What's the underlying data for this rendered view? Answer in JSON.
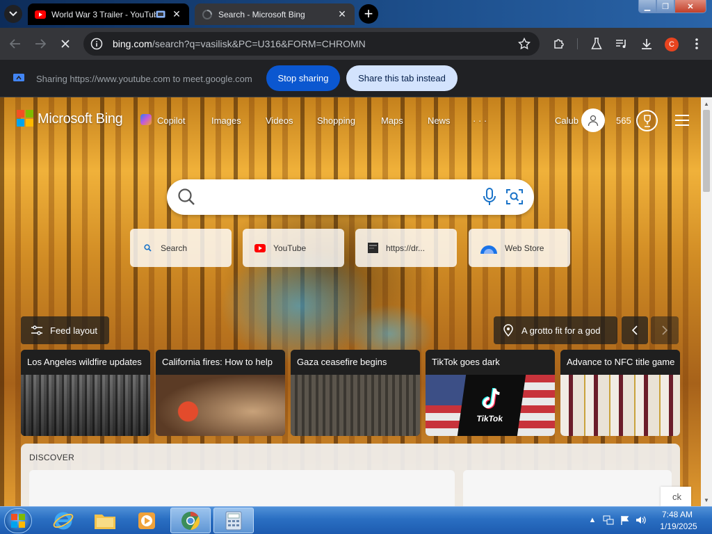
{
  "browser": {
    "tabs": [
      {
        "title": "World War 3 Trailer - YouTube",
        "favicon": "youtube-icon",
        "sharing": true
      },
      {
        "title": "Search - Microsoft Bing",
        "favicon": "loading-icon",
        "active": true
      }
    ],
    "new_tab": "+",
    "url_host": "bing.com",
    "url_path": "/search?q=vasilisk&PC=U316&FORM=CHROMN",
    "profile_initial": "C",
    "profile_color": "#e8441f"
  },
  "share_bar": {
    "message": "Sharing https://www.youtube.com to meet.google.com",
    "stop_label": "Stop sharing",
    "share_tab_label": "Share this tab instead"
  },
  "bing": {
    "logo_text": "Microsoft Bing",
    "nav": [
      "Copilot",
      "Images",
      "Videos",
      "Shopping",
      "Maps",
      "News",
      "· · ·"
    ],
    "user_name": "Calub",
    "points": "565",
    "quick_links": [
      {
        "label": "Search",
        "icon": "search-icon"
      },
      {
        "label": "YouTube",
        "icon": "youtube-icon"
      },
      {
        "label": "https://dr...",
        "icon": "site-icon"
      },
      {
        "label": "Web Store",
        "icon": "web-store-icon"
      }
    ],
    "feed_layout_label": "Feed layout",
    "image_caption": "A grotto fit for a god",
    "cards": [
      {
        "title": "Los Angeles wildfire updates"
      },
      {
        "title": "California fires: How to help"
      },
      {
        "title": "Gaza ceasefire begins"
      },
      {
        "title": "TikTok goes dark",
        "badge": "TikTok"
      },
      {
        "title": "Advance to NFC title game"
      }
    ],
    "discover_label": "DISCOVER",
    "feedback_partial": "ck"
  },
  "taskbar": {
    "time": "7:48 AM",
    "date": "1/19/2025",
    "tray_arrow": "▲"
  },
  "colors": {
    "accent_blue": "#0b57d0",
    "share_tab_bg": "#d3e3fd",
    "youtube_red": "#ff0000"
  }
}
